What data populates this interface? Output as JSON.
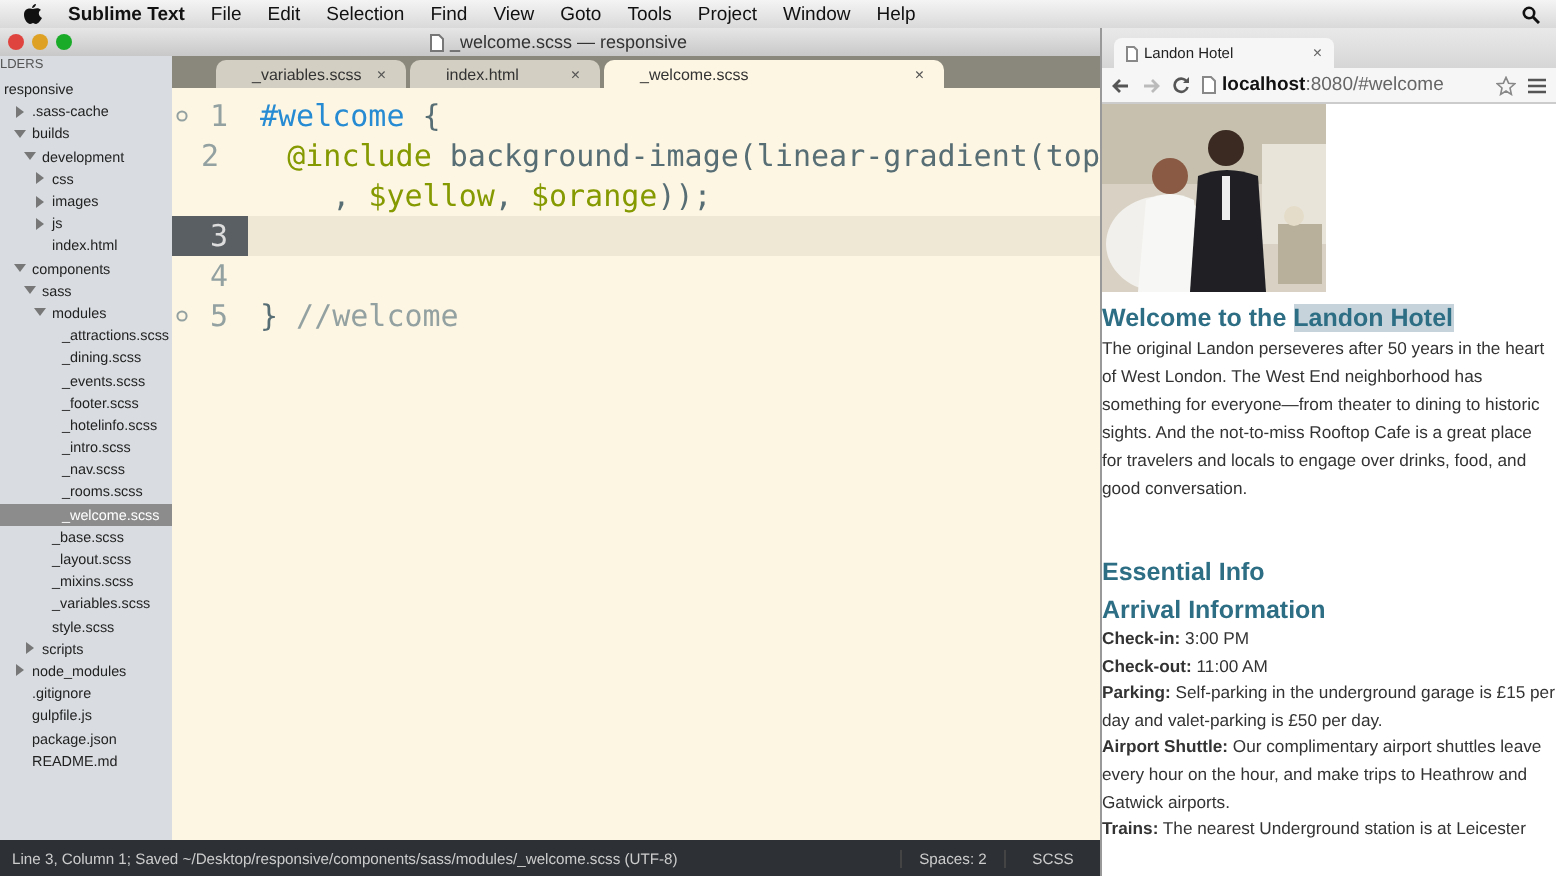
{
  "menubar": {
    "app": "Sublime Text",
    "items": [
      "File",
      "Edit",
      "Selection",
      "Find",
      "View",
      "Goto",
      "Tools",
      "Project",
      "Window",
      "Help"
    ]
  },
  "window": {
    "title": "_welcome.scss — responsive"
  },
  "sidebar": {
    "header": "LDERS",
    "items": [
      {
        "label": "responsive",
        "selected": false,
        "children": [
          {
            "label": ".sass-cache",
            "kind": "folder",
            "expanded": false,
            "selected": false
          },
          {
            "label": "builds",
            "kind": "folder",
            "expanded": true,
            "selected": false,
            "children": [
              {
                "label": "development",
                "kind": "folder",
                "expanded": true,
                "selected": false,
                "children": [
                  {
                    "label": "css",
                    "kind": "folder",
                    "expanded": false,
                    "selected": false
                  },
                  {
                    "label": "images",
                    "kind": "folder",
                    "expanded": false,
                    "selected": false
                  },
                  {
                    "label": "js",
                    "kind": "folder",
                    "expanded": false,
                    "selected": false
                  },
                  {
                    "label": "index.html",
                    "kind": "file",
                    "selected": false
                  }
                ]
              }
            ]
          },
          {
            "label": "components",
            "kind": "folder",
            "expanded": true,
            "selected": false,
            "children": [
              {
                "label": "sass",
                "kind": "folder",
                "expanded": true,
                "selected": false,
                "children": [
                  {
                    "label": "modules",
                    "kind": "folder",
                    "expanded": true,
                    "selected": false,
                    "children": [
                      {
                        "label": "_attractions.scss",
                        "kind": "file",
                        "selected": false
                      },
                      {
                        "label": "_dining.scss",
                        "kind": "file",
                        "selected": false
                      },
                      {
                        "label": "_events.scss",
                        "kind": "file",
                        "selected": false
                      },
                      {
                        "label": "_footer.scss",
                        "kind": "file",
                        "selected": false
                      },
                      {
                        "label": "_hotelinfo.scss",
                        "kind": "file",
                        "selected": false
                      },
                      {
                        "label": "_intro.scss",
                        "kind": "file",
                        "selected": false
                      },
                      {
                        "label": "_nav.scss",
                        "kind": "file",
                        "selected": false
                      },
                      {
                        "label": "_rooms.scss",
                        "kind": "file",
                        "selected": false
                      },
                      {
                        "label": "_welcome.scss",
                        "kind": "file",
                        "selected": true
                      }
                    ]
                  },
                  {
                    "label": "_base.scss",
                    "kind": "file",
                    "selected": false
                  },
                  {
                    "label": "_layout.scss",
                    "kind": "file",
                    "selected": false
                  },
                  {
                    "label": "_mixins.scss",
                    "kind": "file",
                    "selected": false
                  },
                  {
                    "label": "_variables.scss",
                    "kind": "file",
                    "selected": false
                  },
                  {
                    "label": "style.scss",
                    "kind": "file",
                    "selected": false
                  }
                ]
              },
              {
                "label": "scripts",
                "kind": "folder",
                "expanded": false,
                "selected": false
              }
            ]
          },
          {
            "label": "node_modules",
            "kind": "folder",
            "expanded": false,
            "selected": false
          },
          {
            "label": ".gitignore",
            "kind": "file",
            "selected": false
          },
          {
            "label": "gulpfile.js",
            "kind": "file",
            "selected": false
          },
          {
            "label": "package.json",
            "kind": "file",
            "selected": false
          },
          {
            "label": "README.md",
            "kind": "file",
            "selected": false
          }
        ]
      }
    ]
  },
  "tabs": [
    {
      "label": "_variables.scss",
      "close": "×",
      "selected": false
    },
    {
      "label": "index.html",
      "close": "×",
      "selected": false
    },
    {
      "label": "_welcome.scss",
      "close": "×",
      "selected": true
    }
  ],
  "editor": {
    "lines": [
      {
        "number": "1",
        "fold": true,
        "current": false,
        "tokens": [
          {
            "text": "#welcome",
            "kind": "selector"
          },
          {
            "text": " {",
            "kind": "brace"
          }
        ]
      },
      {
        "number": "2",
        "fold": false,
        "current": false,
        "tokens": [
          {
            "text": "  @include",
            "kind": "keyword"
          },
          {
            "text": " background-image(linear-gradient(top",
            "kind": "plain"
          }
        ]
      },
      {
        "fold": false,
        "current": false,
        "tokens": [
          {
            "text": "    , ",
            "kind": "plain"
          },
          {
            "text": "$yellow",
            "kind": "variable"
          },
          {
            "text": ", ",
            "kind": "plain"
          },
          {
            "text": "$orange",
            "kind": "variable"
          },
          {
            "text": "));",
            "kind": "plain"
          }
        ]
      },
      {
        "number": "3",
        "fold": false,
        "current": true
      },
      {
        "number": "4",
        "fold": false,
        "current": false
      },
      {
        "number": "5",
        "fold": true,
        "current": false,
        "tokens": [
          {
            "text": "}",
            "kind": "brace"
          },
          {
            "text": " //welcome",
            "kind": "comment"
          }
        ]
      }
    ]
  },
  "status_bar": {
    "position": "Line 3, Column 1; Saved ~/Desktop/responsive/components/sass/modules/_welcome.scss (UTF-8)",
    "indent": "Spaces: 2",
    "syntax": "SCSS"
  },
  "browser": {
    "tab": {
      "title": "Landon Hotel",
      "close": "×"
    },
    "url_host": "localhost",
    "url_rest": ":8080/#welcome",
    "page": {
      "heading": "Welcome to the",
      "heading_highlight": "Landon Hotel",
      "intro": "The original Landon perseveres after 50 years in the heart of West London. The West End neighborhood has something for everyone—from theater to dining to historic sights. And the not-to-miss Rooftop Cafe is a great place for travelers and locals to engage over drinks, food, and good conversation.",
      "section": "Essential Info",
      "subsection": "Arrival Information",
      "info": [
        {
          "label": "Check-in:",
          "text": "3:00 PM"
        },
        {
          "label": "Check-out:",
          "text": "11:00 AM"
        },
        {
          "label": "Parking:",
          "text": "Self-parking in the underground garage is £15 per day and valet-parking is £50 per day."
        },
        {
          "label": "Airport Shuttle:",
          "text": "Our complimentary airport shuttles leave every hour on the hour, and make trips to Heathrow and Gatwick airports."
        },
        {
          "label": "Trains:",
          "text": "The nearest Underground station is at Leicester"
        }
      ]
    }
  }
}
